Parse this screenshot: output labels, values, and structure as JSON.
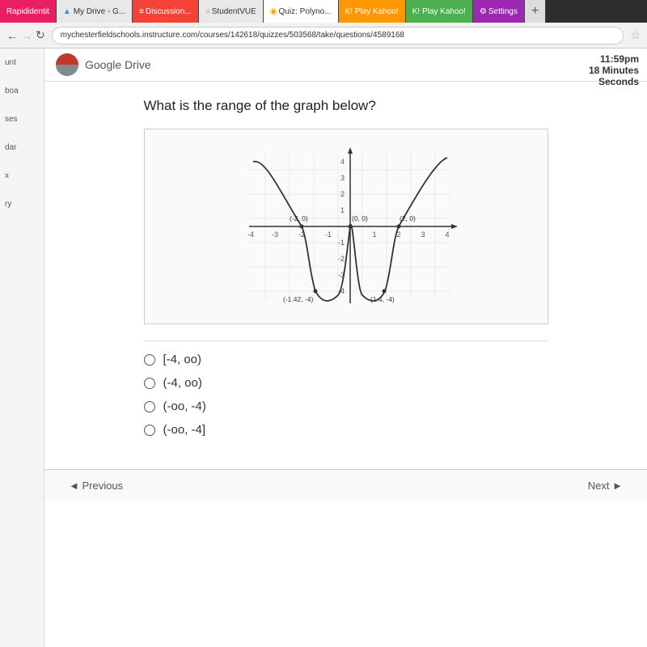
{
  "browser": {
    "tabs": [
      {
        "label": "Rapididentit",
        "type": "pink"
      },
      {
        "label": "My Drive - G...",
        "type": "default"
      },
      {
        "label": "Discussion...",
        "type": "red"
      },
      {
        "label": "StudentVUE",
        "type": "default"
      },
      {
        "label": "Quiz: Polyno...",
        "type": "blue",
        "active": true
      },
      {
        "label": "K! Play Kahoo!",
        "type": "orange"
      },
      {
        "label": "K! Play Kahoo!",
        "type": "green"
      },
      {
        "label": "Settings",
        "type": "settings"
      },
      {
        "label": "+",
        "type": "default"
      }
    ],
    "address": "mychesterfieldschools.instructure.com/courses/142618/quizzes/503568/take/questions/4589168"
  },
  "header": {
    "google_drive_label": "Google Drive"
  },
  "timer": {
    "time": "11:59pm",
    "minutes_label": "18 Minutes",
    "seconds_label": "Seconds"
  },
  "sidebar": {
    "items": [
      "unt",
      "boa",
      "ses",
      "dar",
      "x",
      "ry"
    ]
  },
  "question": {
    "text": "What is the range of the graph below?",
    "graph": {
      "x_min": -4,
      "x_max": 4,
      "y_min": -5,
      "y_max": 4,
      "points": [
        {
          "label": "(-2, 0)",
          "x": -2,
          "y": 0
        },
        {
          "label": "(0, 0)",
          "x": 0,
          "y": 0
        },
        {
          "label": "(2, 0)",
          "x": 2,
          "y": 0
        },
        {
          "label": "(-1.42, -4)",
          "x": -1.42,
          "y": -4
        },
        {
          "label": "(1.4, -4)",
          "x": 1.4,
          "y": -4
        }
      ]
    },
    "choices": [
      {
        "id": "a",
        "label": "[-4, oo)"
      },
      {
        "id": "b",
        "label": "(-4, oo)"
      },
      {
        "id": "c",
        "label": "(-oo, -4)"
      },
      {
        "id": "d",
        "label": "(-oo, -4]"
      }
    ]
  },
  "navigation": {
    "previous_label": "◄ Previous",
    "next_label": "Next ►"
  }
}
